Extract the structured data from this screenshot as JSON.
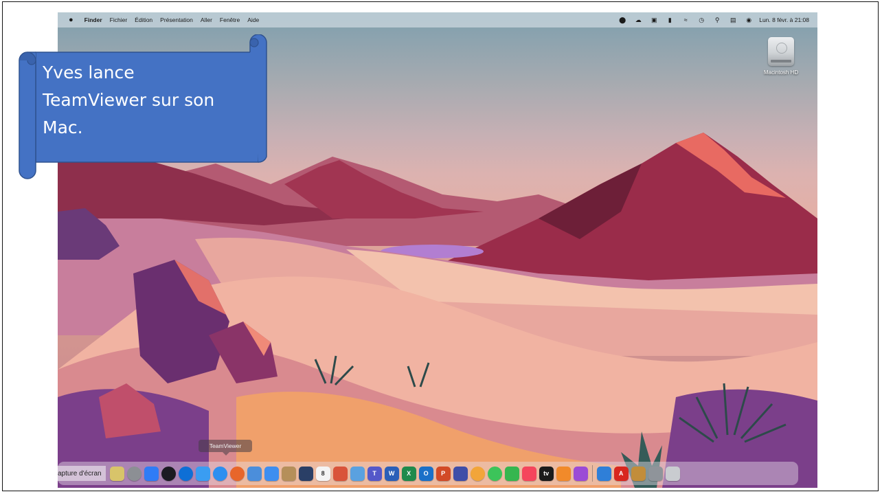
{
  "menu_bar": {
    "apple_icon": "apple-icon",
    "items": [
      "Finder",
      "Fichier",
      "Édition",
      "Présentation",
      "Aller",
      "Fenêtre",
      "Aide"
    ],
    "status_icons": [
      "screen-record-icon",
      "cloud-icon",
      "teamviewer-status-icon",
      "battery-icon",
      "wifi-icon",
      "time-machine-icon",
      "search-icon",
      "control-center-icon",
      "siri-icon"
    ],
    "clock": "Lun. 8 févr. à 21:08"
  },
  "desktop": {
    "disk_label": "Macintosh HD"
  },
  "tooltip": {
    "text": "TeamViewer"
  },
  "dock": {
    "partial_label": "apture d'écran",
    "icons": [
      {
        "name": "launchpad-icon",
        "color": "#d8c46a"
      },
      {
        "name": "system-preferences-icon",
        "color": "#8c8f94"
      },
      {
        "name": "app-store-icon",
        "color": "#2f7cf6"
      },
      {
        "name": "speedtest-icon",
        "color": "#1b1b22"
      },
      {
        "name": "teamviewer-icon",
        "color": "#0e6fd6"
      },
      {
        "name": "finder-icon",
        "color": "#3a9df2"
      },
      {
        "name": "safari-icon",
        "color": "#2d8ff0"
      },
      {
        "name": "firefox-icon",
        "color": "#e8662a"
      },
      {
        "name": "preview-icon",
        "color": "#4b8edb"
      },
      {
        "name": "mail-icon",
        "color": "#3e8ef0"
      },
      {
        "name": "contacts-icon",
        "color": "#b58f5a"
      },
      {
        "name": "quicktime-icon",
        "color": "#2a3f66"
      },
      {
        "name": "calendar-icon",
        "color": "#f4f4f4"
      },
      {
        "name": "garageband-icon",
        "color": "#d9533a"
      },
      {
        "name": "preview-photos-icon",
        "color": "#5aa1e0"
      },
      {
        "name": "teams-icon",
        "color": "#5458c9"
      },
      {
        "name": "word-icon",
        "color": "#2b5fb8"
      },
      {
        "name": "excel-icon",
        "color": "#1f8a4c"
      },
      {
        "name": "outlook-icon",
        "color": "#1a70c8"
      },
      {
        "name": "powerpoint-icon",
        "color": "#d24a26"
      },
      {
        "name": "screen-icon",
        "color": "#3e4ea8"
      },
      {
        "name": "photos-icon",
        "color": "#f2a53a"
      },
      {
        "name": "messages-icon",
        "color": "#3cc45a"
      },
      {
        "name": "facetime-icon",
        "color": "#35b64f"
      },
      {
        "name": "music-icon",
        "color": "#f5455c"
      },
      {
        "name": "apple-tv-icon",
        "color": "#1b1b1b"
      },
      {
        "name": "books-icon",
        "color": "#f18a2a"
      },
      {
        "name": "podcasts-icon",
        "color": "#9b4bd6"
      },
      {
        "name": "onedrive-icon",
        "color": "#2f7fd8"
      },
      {
        "name": "acrobat-icon",
        "color": "#d8261f"
      },
      {
        "name": "grapher-icon",
        "color": "#c28d3a"
      },
      {
        "name": "downloads-stack-icon",
        "color": "#8f949a"
      },
      {
        "name": "trash-icon",
        "color": "#c9ccd0"
      }
    ]
  },
  "callout": {
    "text": "Yves lance TeamViewer sur son Mac."
  },
  "colors": {
    "callout_fill": "#4472c4",
    "callout_stroke": "#2f528f"
  }
}
